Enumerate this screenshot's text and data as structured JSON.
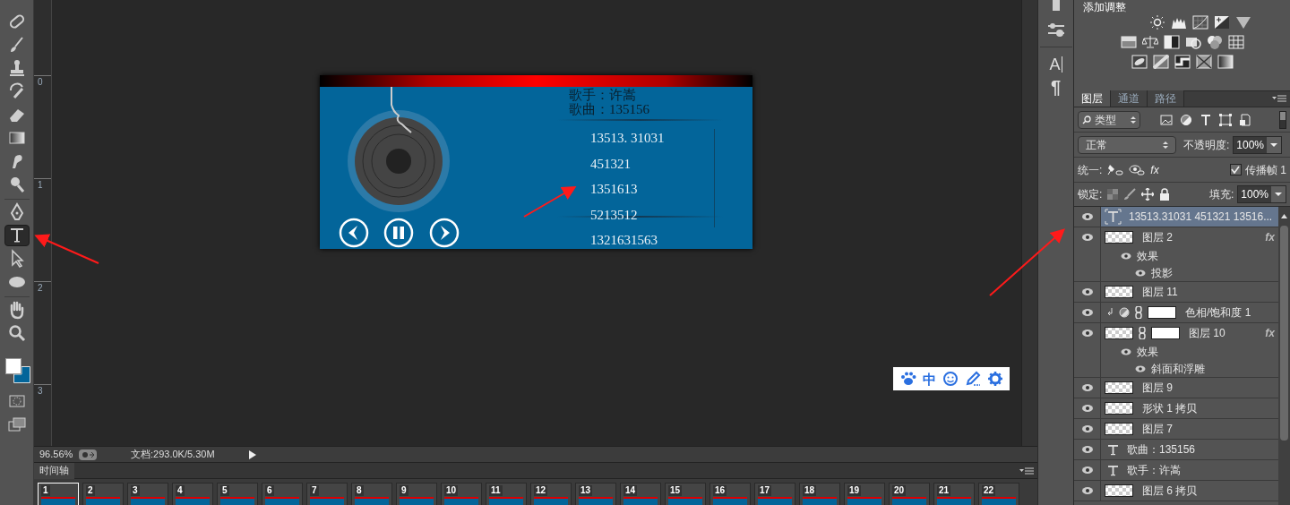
{
  "tools": [
    {
      "kind": "healing",
      "selected": false
    },
    {
      "kind": "brush",
      "selected": false
    },
    {
      "kind": "stamp",
      "selected": false
    },
    {
      "kind": "history-brush",
      "selected": false
    },
    {
      "kind": "eraser",
      "selected": false
    },
    {
      "kind": "gradient",
      "selected": false
    },
    {
      "kind": "smudge",
      "selected": false
    },
    {
      "kind": "dodge",
      "selected": false
    },
    {
      "kind": "pen",
      "selected": false
    },
    {
      "kind": "type",
      "selected": true
    },
    {
      "kind": "path-select",
      "selected": false
    },
    {
      "kind": "ellipse",
      "selected": false
    },
    {
      "kind": "hand",
      "selected": false
    },
    {
      "kind": "zoom",
      "selected": false
    }
  ],
  "ruler": [
    "0",
    "1",
    "2",
    "3"
  ],
  "artwork": {
    "singer": "歌手：许嵩",
    "song": "歌曲：135156",
    "playlist": [
      "13513. 31031",
      "451321",
      "1351613",
      "5213512",
      "1321631563"
    ]
  },
  "ime_toolbar": {
    "mode": "中"
  },
  "status_bar": {
    "zoom": "96.56%",
    "document": "文档:293.0K/5.30M"
  },
  "timeline": {
    "tab": "时间轴",
    "frames": [
      {
        "number": "1",
        "selected": true
      },
      {
        "number": "2",
        "selected": false
      },
      {
        "number": "3",
        "selected": false
      },
      {
        "number": "4",
        "selected": false
      },
      {
        "number": "5",
        "selected": false
      },
      {
        "number": "6",
        "selected": false
      },
      {
        "number": "7",
        "selected": false
      },
      {
        "number": "8",
        "selected": false
      },
      {
        "number": "9",
        "selected": false
      },
      {
        "number": "10",
        "selected": false
      },
      {
        "number": "11",
        "selected": false
      },
      {
        "number": "12",
        "selected": false
      },
      {
        "number": "13",
        "selected": false
      },
      {
        "number": "14",
        "selected": false
      },
      {
        "number": "15",
        "selected": false
      },
      {
        "number": "16",
        "selected": false
      },
      {
        "number": "17",
        "selected": false
      },
      {
        "number": "18",
        "selected": false
      },
      {
        "number": "19",
        "selected": false
      },
      {
        "number": "20",
        "selected": false
      },
      {
        "number": "21",
        "selected": false
      },
      {
        "number": "22",
        "selected": false
      }
    ]
  },
  "side_panel": {
    "character": "A",
    "paragraph": "¶"
  },
  "adjustments": {
    "title": "添加调整"
  },
  "layers_panel": {
    "tabs": [
      {
        "label": "图层",
        "selected": true
      },
      {
        "label": "通道",
        "selected": false
      },
      {
        "label": "路径",
        "selected": false
      }
    ],
    "filter": "类型",
    "blend_mode": "正常",
    "opacity_label": "不透明度:",
    "opacity": "100%",
    "unify_label": "统一:",
    "unify_style": "fx",
    "propagate": {
      "label": "传播帧",
      "value": "1",
      "checked": true
    },
    "lock_label": "锁定:",
    "fill_label": "填充:",
    "fill": "100%",
    "layers": [
      {
        "kind": "text",
        "name": "13513.31031 451321 13516...",
        "selected": true
      },
      {
        "kind": "pixel",
        "name": "图层 2",
        "selected": false,
        "badge": "fx",
        "effects": {
          "label": "效果",
          "items": [
            "投影"
          ]
        }
      },
      {
        "kind": "pixel",
        "name": "图层 11",
        "selected": false
      },
      {
        "kind": "adjustment",
        "name": "色相/饱和度 1",
        "selected": false
      },
      {
        "kind": "masked",
        "name": "图层 10",
        "selected": false,
        "badge": "fx",
        "effects": {
          "label": "效果",
          "items": [
            "斜面和浮雕"
          ]
        }
      },
      {
        "kind": "pixel",
        "name": "图层 9",
        "selected": false
      },
      {
        "kind": "pixel",
        "name": "形状 1 拷贝",
        "selected": false
      },
      {
        "kind": "pixel",
        "name": "图层 7",
        "selected": false
      },
      {
        "kind": "text",
        "name": "歌曲：135156",
        "selected": false
      },
      {
        "kind": "text",
        "name": "歌手：许嵩",
        "selected": false
      },
      {
        "kind": "pixel",
        "name": "图层 6 拷贝",
        "selected": false
      }
    ]
  }
}
